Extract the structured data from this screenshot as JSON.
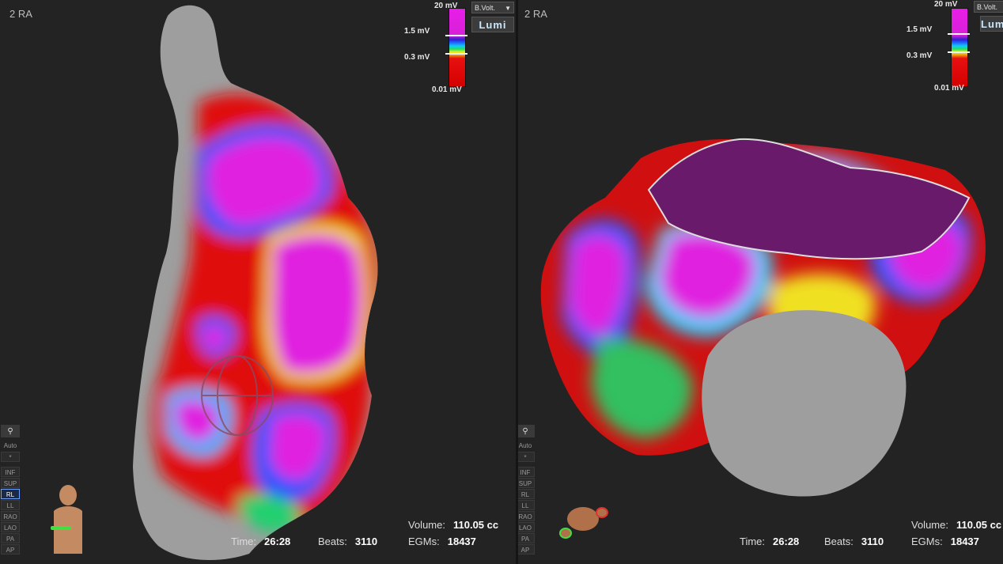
{
  "left_panel": {
    "title": "2 RA",
    "legend": {
      "max": "20 mV",
      "high": "1.5 mV",
      "low": "0.3 mV",
      "min": "0.01 mV"
    },
    "map_type_dropdown": "B.Volt.",
    "lumi_button": "Lumi",
    "toolbar": [
      "INF",
      "SUP",
      "RL",
      "LL",
      "RAO",
      "LAO",
      "PA",
      "AP"
    ],
    "toolbar_selected": "RL",
    "toolbar_auto": "Auto",
    "toolbar_star": "*",
    "volume_label": "Volume:",
    "volume_value": "110.05 cc",
    "time_label": "Time:",
    "time_value": "26:28",
    "beats_label": "Beats:",
    "beats_value": "3110",
    "egms_label": "EGMs:",
    "egms_value": "18437"
  },
  "right_panel": {
    "title": "2 RA",
    "legend": {
      "max": "20 mV",
      "high": "1.5 mV",
      "low": "0.3 mV",
      "min": "0.01 mV"
    },
    "map_type_dropdown": "B.Volt.",
    "lumi_button": "Lumi",
    "toolbar": [
      "INF",
      "SUP",
      "RL",
      "LL",
      "RAO",
      "LAO",
      "PA",
      "AP"
    ],
    "toolbar_auto": "Auto",
    "toolbar_star": "*",
    "volume_label": "Volume:",
    "volume_value": "110.05 cc",
    "time_label": "Time:",
    "time_value": "26:28",
    "beats_label": "Beats:",
    "beats_value": "3110",
    "egms_label": "EGMs:",
    "egms_value": "18437"
  },
  "colors": {
    "background": "#232323",
    "voltage_high": "#e020e0",
    "voltage_low": "#e01010",
    "voltage_mid_blue": "#2050ff",
    "voltage_mid_green": "#20e060",
    "voltage_mid_yellow": "#f0f020",
    "unmapped_tissue": "#9a9a9a",
    "selected_view": "#6ea0ff"
  },
  "icons": {
    "pin": "pin-icon",
    "orientation_left": "torso-orientation-icon",
    "orientation_right": "heart-orientation-icon"
  }
}
